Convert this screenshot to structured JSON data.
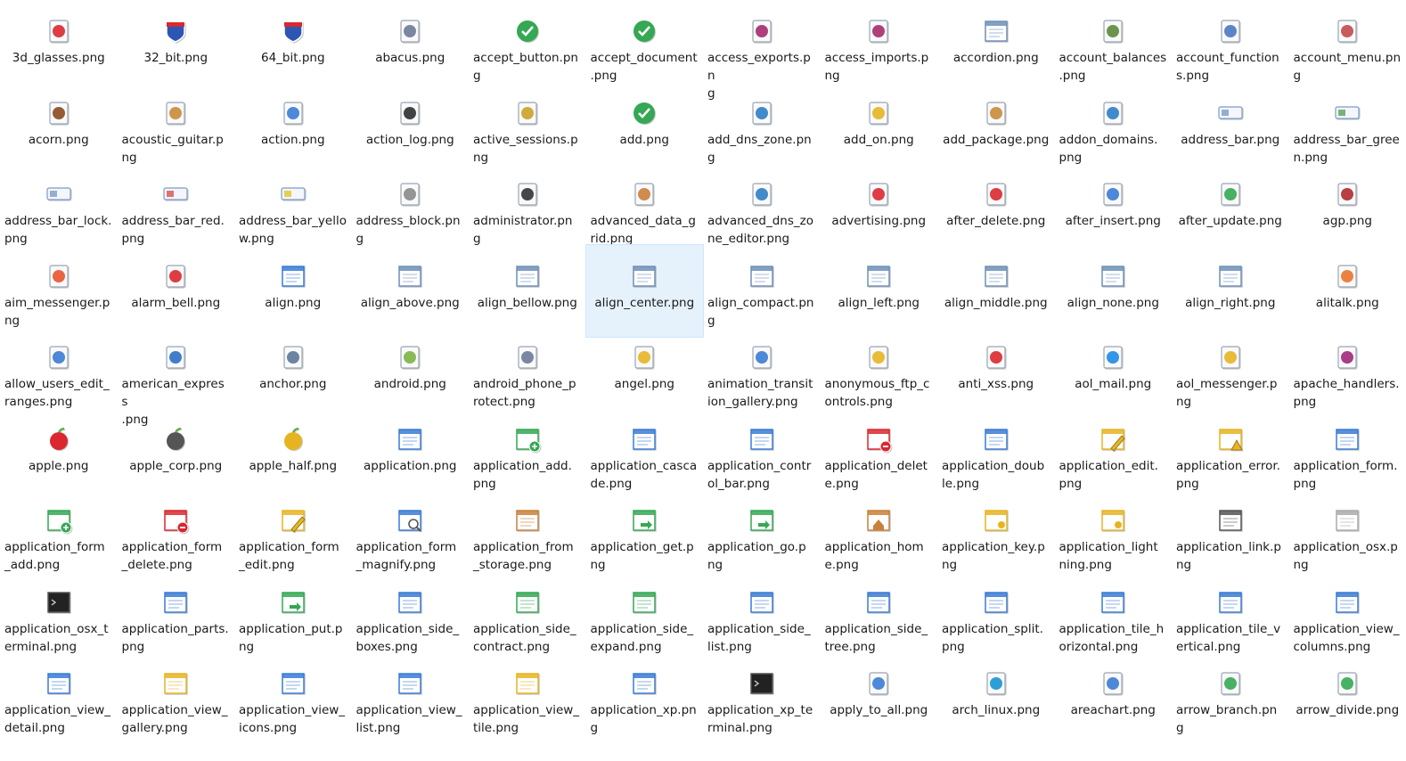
{
  "selected_index": 41,
  "items": [
    {
      "name": "3d_glasses.png",
      "icon": "3d-glasses-icon",
      "color": "#d9282f"
    },
    {
      "name": "32_bit.png",
      "icon": "interstate-32-icon",
      "color": "#2c56b4"
    },
    {
      "name": "64_bit.png",
      "icon": "interstate-64-icon",
      "color": "#2c56b4"
    },
    {
      "name": "abacus.png",
      "icon": "abacus-icon",
      "color": "#6b7a99"
    },
    {
      "name": "accept_button.png",
      "icon": "accept-button-icon",
      "color": "#34a853"
    },
    {
      "name": "accept_document.png",
      "icon": "accept-document-icon",
      "color": "#34a853"
    },
    {
      "name": "access_exports.png",
      "icon": "access-exports-icon",
      "color": "#a52a6b"
    },
    {
      "name": "access_imports.png",
      "icon": "access-imports-icon",
      "color": "#a52a6b"
    },
    {
      "name": "accordion.png",
      "icon": "accordion-icon",
      "color": "#6e8fb8"
    },
    {
      "name": "account_balances.png",
      "icon": "account-balances-icon",
      "color": "#5b8a3c"
    },
    {
      "name": "account_functions.png",
      "icon": "account-functions-icon",
      "color": "#4a78c2"
    },
    {
      "name": "account_menu.png",
      "icon": "account-menu-icon",
      "color": "#c24a4a"
    },
    {
      "name": "acorn.png",
      "icon": "acorn-icon",
      "color": "#8a4a1e"
    },
    {
      "name": "acoustic_guitar.png",
      "icon": "acoustic-guitar-icon",
      "color": "#c98a3a"
    },
    {
      "name": "action.png",
      "icon": "action-icon",
      "color": "#3a7bd5"
    },
    {
      "name": "action_log.png",
      "icon": "action-log-icon",
      "color": "#2d2d2d"
    },
    {
      "name": "active_sessions.png",
      "icon": "active-sessions-icon",
      "color": "#c9a227"
    },
    {
      "name": "add.png",
      "icon": "add-icon",
      "color": "#34a853"
    },
    {
      "name": "add_dns_zone.png",
      "icon": "add-dns-zone-icon",
      "color": "#2e7ec4"
    },
    {
      "name": "add_on.png",
      "icon": "add-on-icon",
      "color": "#e6b422"
    },
    {
      "name": "add_package.png",
      "icon": "add-package-icon",
      "color": "#c98a3a"
    },
    {
      "name": "addon_domains.png",
      "icon": "addon-domains-icon",
      "color": "#2e7ec4"
    },
    {
      "name": "address_bar.png",
      "icon": "address-bar-icon",
      "color": "#7a9cc6"
    },
    {
      "name": "address_bar_green.png",
      "icon": "address-bar-green-icon",
      "color": "#5aa05a"
    },
    {
      "name": "address_bar_lock.png",
      "icon": "address-bar-lock-icon",
      "color": "#7a9cc6"
    },
    {
      "name": "address_bar_red.png",
      "icon": "address-bar-red-icon",
      "color": "#d9534f"
    },
    {
      "name": "address_bar_yellow.png",
      "icon": "address-bar-yellow-icon",
      "color": "#e6c229"
    },
    {
      "name": "address_block.png",
      "icon": "address-block-icon",
      "color": "#8a8a8a"
    },
    {
      "name": "administrator.png",
      "icon": "administrator-icon",
      "color": "#333333"
    },
    {
      "name": "advanced_data_grid.png",
      "icon": "advanced-data-grid-icon",
      "color": "#c9803a"
    },
    {
      "name": "advanced_dns_zone_editor.png",
      "icon": "advanced-dns-zone-editor-icon",
      "color": "#2e7ec4"
    },
    {
      "name": "advertising.png",
      "icon": "advertising-icon",
      "color": "#d9282f"
    },
    {
      "name": "after_delete.png",
      "icon": "after-delete-icon",
      "color": "#d9282f"
    },
    {
      "name": "after_insert.png",
      "icon": "after-insert-icon",
      "color": "#3a7bd5"
    },
    {
      "name": "after_update.png",
      "icon": "after-update-icon",
      "color": "#34a853"
    },
    {
      "name": "agp.png",
      "icon": "agp-icon",
      "color": "#b02b2b"
    },
    {
      "name": "aim_messenger.png",
      "icon": "aim-messenger-icon",
      "color": "#e8542a"
    },
    {
      "name": "alarm_bell.png",
      "icon": "alarm-bell-icon",
      "color": "#d9282f"
    },
    {
      "name": "align.png",
      "icon": "align-icon",
      "color": "#3a7bd5"
    },
    {
      "name": "align_above.png",
      "icon": "align-above-icon",
      "color": "#6e8fb8"
    },
    {
      "name": "align_bellow.png",
      "icon": "align-bellow-icon",
      "color": "#6e8fb8"
    },
    {
      "name": "align_center.png",
      "icon": "align-center-icon",
      "color": "#6e8fb8"
    },
    {
      "name": "align_compact.png",
      "icon": "align-compact-icon",
      "color": "#6e8fb8"
    },
    {
      "name": "align_left.png",
      "icon": "align-left-icon",
      "color": "#6e8fb8"
    },
    {
      "name": "align_middle.png",
      "icon": "align-middle-icon",
      "color": "#6e8fb8"
    },
    {
      "name": "align_none.png",
      "icon": "align-none-icon",
      "color": "#6e8fb8"
    },
    {
      "name": "align_right.png",
      "icon": "align-right-icon",
      "color": "#6e8fb8"
    },
    {
      "name": "alitalk.png",
      "icon": "alitalk-icon",
      "color": "#e8742a"
    },
    {
      "name": "allow_users_edit_ranges.png",
      "icon": "allow-users-edit-ranges-icon",
      "color": "#3a7bd5"
    },
    {
      "name": "american_express.png",
      "icon": "american-express-icon",
      "color": "#2e6fc4"
    },
    {
      "name": "anchor.png",
      "icon": "anchor-icon",
      "color": "#5a7896"
    },
    {
      "name": "android.png",
      "icon": "android-icon",
      "color": "#7cb342"
    },
    {
      "name": "android_phone_protect.png",
      "icon": "android-phone-protect-icon",
      "color": "#6b7a99"
    },
    {
      "name": "angel.png",
      "icon": "angel-icon",
      "color": "#e6b422"
    },
    {
      "name": "animation_transition_gallery.png",
      "icon": "animation-transition-gallery-icon",
      "color": "#3a7bd5"
    },
    {
      "name": "anonymous_ftp_controls.png",
      "icon": "anonymous-ftp-controls-icon",
      "color": "#e6b422"
    },
    {
      "name": "anti_xss.png",
      "icon": "anti-xss-icon",
      "color": "#d9282f"
    },
    {
      "name": "aol_mail.png",
      "icon": "aol-mail-icon",
      "color": "#1e88e5"
    },
    {
      "name": "aol_messenger.png",
      "icon": "aol-messenger-icon",
      "color": "#e6b422"
    },
    {
      "name": "apache_handlers.png",
      "icon": "apache-handlers-icon",
      "color": "#a0287a"
    },
    {
      "name": "apple.png",
      "icon": "apple-icon",
      "color": "#d9282f"
    },
    {
      "name": "apple_corp.png",
      "icon": "apple-corp-icon",
      "color": "#555555"
    },
    {
      "name": "apple_half.png",
      "icon": "apple-half-icon",
      "color": "#e6b422"
    },
    {
      "name": "application.png",
      "icon": "application-icon",
      "color": "#3a7bd5"
    },
    {
      "name": "application_add.png",
      "icon": "application-add-icon",
      "color": "#34a853"
    },
    {
      "name": "application_cascade.png",
      "icon": "application-cascade-icon",
      "color": "#3a7bd5"
    },
    {
      "name": "application_control_bar.png",
      "icon": "application-control-bar-icon",
      "color": "#3a7bd5"
    },
    {
      "name": "application_delete.png",
      "icon": "application-delete-icon",
      "color": "#d9282f"
    },
    {
      "name": "application_double.png",
      "icon": "application-double-icon",
      "color": "#3a7bd5"
    },
    {
      "name": "application_edit.png",
      "icon": "application-edit-icon",
      "color": "#e6b422"
    },
    {
      "name": "application_error.png",
      "icon": "application-error-icon",
      "color": "#e6b422"
    },
    {
      "name": "application_form.png",
      "icon": "application-form-icon",
      "color": "#3a7bd5"
    },
    {
      "name": "application_form_add.png",
      "icon": "application-form-add-icon",
      "color": "#34a853"
    },
    {
      "name": "application_form_delete.png",
      "icon": "application-form-delete-icon",
      "color": "#d9282f"
    },
    {
      "name": "application_form_edit.png",
      "icon": "application-form-edit-icon",
      "color": "#e6b422"
    },
    {
      "name": "application_form_magnify.png",
      "icon": "application-form-magnify-icon",
      "color": "#3a7bd5"
    },
    {
      "name": "application_from_storage.png",
      "icon": "application-from-storage-icon",
      "color": "#c9803a"
    },
    {
      "name": "application_get.png",
      "icon": "application-get-icon",
      "color": "#34a853"
    },
    {
      "name": "application_go.png",
      "icon": "application-go-icon",
      "color": "#34a853"
    },
    {
      "name": "application_home.png",
      "icon": "application-home-icon",
      "color": "#c9803a"
    },
    {
      "name": "application_key.png",
      "icon": "application-key-icon",
      "color": "#e6b422"
    },
    {
      "name": "application_lightning.png",
      "icon": "application-lightning-icon",
      "color": "#e6b422"
    },
    {
      "name": "application_link.png",
      "icon": "application-link-icon",
      "color": "#555555"
    },
    {
      "name": "application_osx.png",
      "icon": "application-osx-icon",
      "color": "#aaaaaa"
    },
    {
      "name": "application_osx_terminal.png",
      "icon": "application-osx-terminal-icon",
      "color": "#222222"
    },
    {
      "name": "application_parts.png",
      "icon": "application-parts-icon",
      "color": "#3a7bd5"
    },
    {
      "name": "application_put.png",
      "icon": "application-put-icon",
      "color": "#34a853"
    },
    {
      "name": "application_side_boxes.png",
      "icon": "application-side-boxes-icon",
      "color": "#3a7bd5"
    },
    {
      "name": "application_side_contract.png",
      "icon": "application-side-contract-icon",
      "color": "#34a853"
    },
    {
      "name": "application_side_expand.png",
      "icon": "application-side-expand-icon",
      "color": "#34a853"
    },
    {
      "name": "application_side_list.png",
      "icon": "application-side-list-icon",
      "color": "#3a7bd5"
    },
    {
      "name": "application_side_tree.png",
      "icon": "application-side-tree-icon",
      "color": "#3a7bd5"
    },
    {
      "name": "application_split.png",
      "icon": "application-split-icon",
      "color": "#3a7bd5"
    },
    {
      "name": "application_tile_horizontal.png",
      "icon": "application-tile-horizontal-icon",
      "color": "#3a7bd5"
    },
    {
      "name": "application_tile_vertical.png",
      "icon": "application-tile-vertical-icon",
      "color": "#3a7bd5"
    },
    {
      "name": "application_view_columns.png",
      "icon": "application-view-columns-icon",
      "color": "#3a7bd5"
    },
    {
      "name": "application_view_detail.png",
      "icon": "application-view-detail-icon",
      "color": "#3a7bd5"
    },
    {
      "name": "application_view_gallery.png",
      "icon": "application-view-gallery-icon",
      "color": "#e6b422"
    },
    {
      "name": "application_view_icons.png",
      "icon": "application-view-icons-icon",
      "color": "#3a7bd5"
    },
    {
      "name": "application_view_list.png",
      "icon": "application-view-list-icon",
      "color": "#3a7bd5"
    },
    {
      "name": "application_view_tile.png",
      "icon": "application-view-tile-icon",
      "color": "#e6b422"
    },
    {
      "name": "application_xp.png",
      "icon": "application-xp-icon",
      "color": "#3a7bd5"
    },
    {
      "name": "application_xp_terminal.png",
      "icon": "application-xp-terminal-icon",
      "color": "#222222"
    },
    {
      "name": "apply_to_all.png",
      "icon": "apply-to-all-icon",
      "color": "#3a7bd5"
    },
    {
      "name": "arch_linux.png",
      "icon": "arch-linux-icon",
      "color": "#1793d1"
    },
    {
      "name": "areachart.png",
      "icon": "areachart-icon",
      "color": "#3a7bd5"
    },
    {
      "name": "arrow_branch.png",
      "icon": "arrow-branch-icon",
      "color": "#34a853"
    },
    {
      "name": "arrow_divide.png",
      "icon": "arrow-divide-icon",
      "color": "#34a853"
    }
  ],
  "labels": [
    [
      "3d_glasses.png"
    ],
    [
      "32_bit.png"
    ],
    [
      "64_bit.png"
    ],
    [
      "abacus.png"
    ],
    [
      "accept_button.pn",
      "g"
    ],
    [
      "accept_document",
      ".png"
    ],
    [
      "access_exports.pn",
      "g"
    ],
    [
      "access_imports.p",
      "ng"
    ],
    [
      "accordion.png"
    ],
    [
      "account_balances",
      ".png"
    ],
    [
      "account_function",
      "s.png"
    ],
    [
      "account_menu.pn",
      "g"
    ],
    [
      "acorn.png"
    ],
    [
      "acoustic_guitar.p",
      "ng"
    ],
    [
      "action.png"
    ],
    [
      "action_log.png"
    ],
    [
      "active_sessions.p",
      "ng"
    ],
    [
      "add.png"
    ],
    [
      "add_dns_zone.pn",
      "g"
    ],
    [
      "add_on.png"
    ],
    [
      "add_package.png"
    ],
    [
      "addon_domains.",
      "png"
    ],
    [
      "address_bar.png"
    ],
    [
      "address_bar_gree",
      "n.png"
    ],
    [
      "address_bar_lock.",
      "png"
    ],
    [
      "address_bar_red.",
      "png"
    ],
    [
      "address_bar_yello",
      "w.png"
    ],
    [
      "address_block.pn",
      "g"
    ],
    [
      "administrator.pn",
      "g"
    ],
    [
      "advanced_data_g",
      "rid.png"
    ],
    [
      "advanced_dns_zo",
      "ne_editor.png"
    ],
    [
      "advertising.png"
    ],
    [
      "after_delete.png"
    ],
    [
      "after_insert.png"
    ],
    [
      "after_update.png"
    ],
    [
      "agp.png"
    ],
    [
      "aim_messenger.p",
      "ng"
    ],
    [
      "alarm_bell.png"
    ],
    [
      "align.png"
    ],
    [
      "align_above.png"
    ],
    [
      "align_bellow.png"
    ],
    [
      "align_center.png"
    ],
    [
      "align_compact.pn",
      "g"
    ],
    [
      "align_left.png"
    ],
    [
      "align_middle.png"
    ],
    [
      "align_none.png"
    ],
    [
      "align_right.png"
    ],
    [
      "alitalk.png"
    ],
    [
      "allow_users_edit_",
      "ranges.png"
    ],
    [
      "american_express",
      ".png"
    ],
    [
      "anchor.png"
    ],
    [
      "android.png"
    ],
    [
      "android_phone_p",
      "rotect.png"
    ],
    [
      "angel.png"
    ],
    [
      "animation_transit",
      "ion_gallery.png"
    ],
    [
      "anonymous_ftp_c",
      "ontrols.png"
    ],
    [
      "anti_xss.png"
    ],
    [
      "aol_mail.png"
    ],
    [
      "aol_messenger.p",
      "ng"
    ],
    [
      "apache_handlers.",
      "png"
    ],
    [
      "apple.png"
    ],
    [
      "apple_corp.png"
    ],
    [
      "apple_half.png"
    ],
    [
      "application.png"
    ],
    [
      "application_add.",
      "png"
    ],
    [
      "application_casca",
      "de.png"
    ],
    [
      "application_contr",
      "ol_bar.png"
    ],
    [
      "application_delet",
      "e.png"
    ],
    [
      "application_doub",
      "le.png"
    ],
    [
      "application_edit.",
      "png"
    ],
    [
      "application_error.",
      "png"
    ],
    [
      "application_form.",
      "png"
    ],
    [
      "application_form",
      "_add.png"
    ],
    [
      "application_form",
      "_delete.png"
    ],
    [
      "application_form",
      "_edit.png"
    ],
    [
      "application_form",
      "_magnify.png"
    ],
    [
      "application_from",
      "_storage.png"
    ],
    [
      "application_get.p",
      "ng"
    ],
    [
      "application_go.p",
      "ng"
    ],
    [
      "application_hom",
      "e.png"
    ],
    [
      "application_key.p",
      "ng"
    ],
    [
      "application_light",
      "ning.png"
    ],
    [
      "application_link.p",
      "ng"
    ],
    [
      "application_osx.p",
      "ng"
    ],
    [
      "application_osx_t",
      "erminal.png"
    ],
    [
      "application_parts.",
      "png"
    ],
    [
      "application_put.p",
      "ng"
    ],
    [
      "application_side_",
      "boxes.png"
    ],
    [
      "application_side_",
      "contract.png"
    ],
    [
      "application_side_",
      "expand.png"
    ],
    [
      "application_side_",
      "list.png"
    ],
    [
      "application_side_",
      "tree.png"
    ],
    [
      "application_split.",
      "png"
    ],
    [
      "application_tile_h",
      "orizontal.png"
    ],
    [
      "application_tile_v",
      "ertical.png"
    ],
    [
      "application_view_",
      "columns.png"
    ],
    [
      "application_view_",
      "detail.png"
    ],
    [
      "application_view_",
      "gallery.png"
    ],
    [
      "application_view_",
      "icons.png"
    ],
    [
      "application_view_",
      "list.png"
    ],
    [
      "application_view_",
      "tile.png"
    ],
    [
      "application_xp.pn",
      "g"
    ],
    [
      "application_xp_te",
      "rminal.png"
    ],
    [
      "apply_to_all.png"
    ],
    [
      "arch_linux.png"
    ],
    [
      "areachart.png"
    ],
    [
      "arrow_branch.pn",
      "g"
    ],
    [
      "arrow_divide.png"
    ]
  ]
}
